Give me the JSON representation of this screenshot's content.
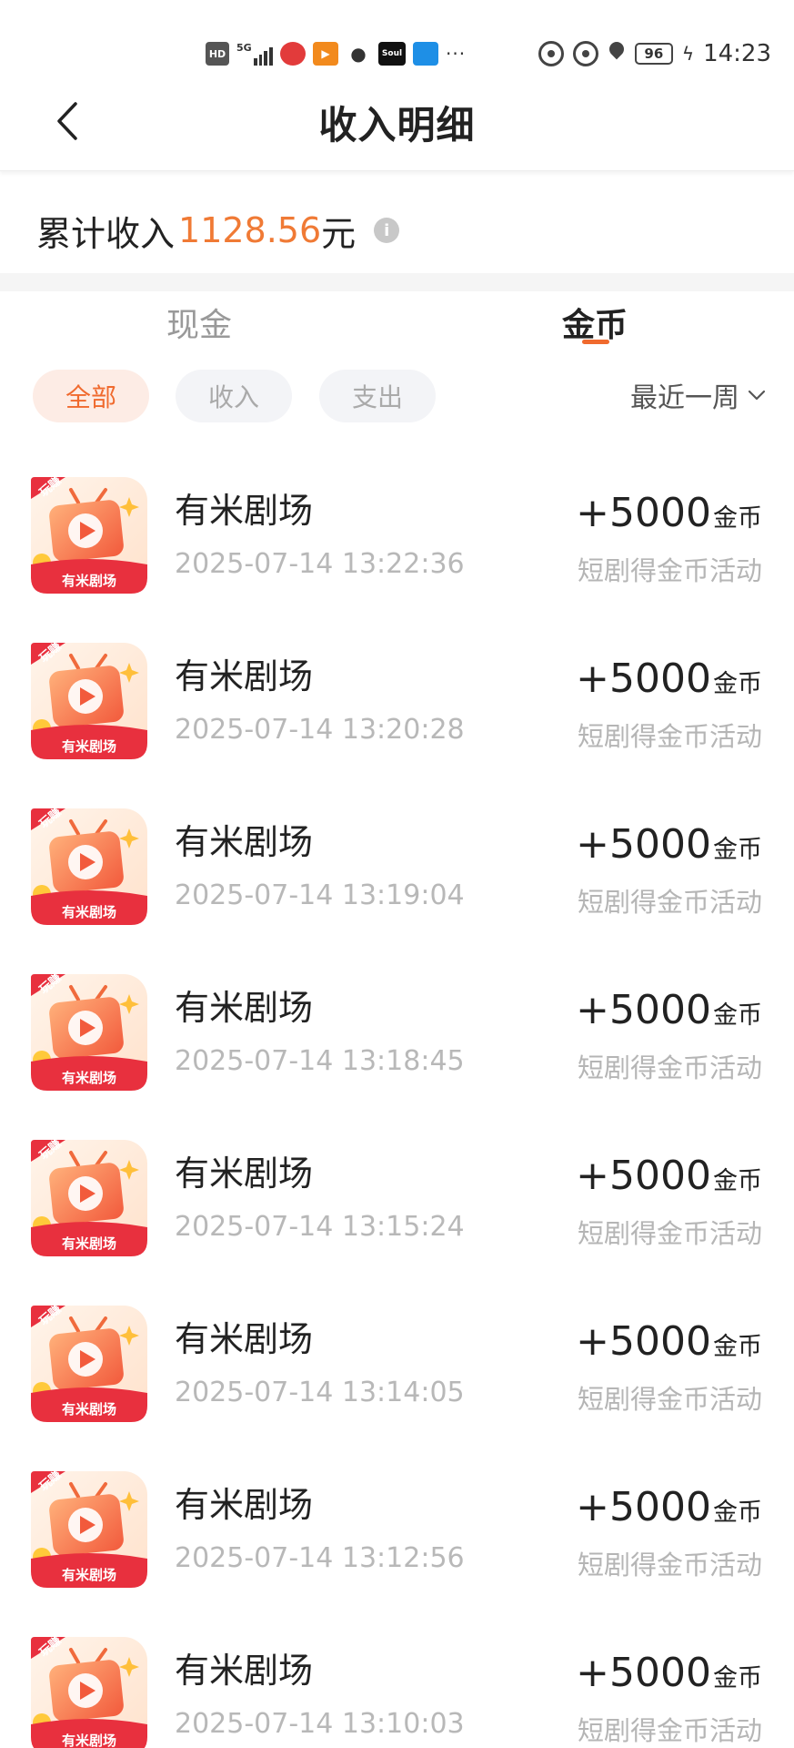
{
  "status_bar": {
    "network_hd": "HD",
    "network_5g": "5G",
    "app_soul": "Soul",
    "more": "···",
    "battery": "96",
    "time": "14:23"
  },
  "header": {
    "title": "收入明细"
  },
  "summary": {
    "label": "累计收入",
    "value": "1128.56",
    "unit": "元",
    "info_icon": "i"
  },
  "tabs": [
    {
      "label": "现金",
      "active": false
    },
    {
      "label": "金币",
      "active": true
    }
  ],
  "filters": [
    {
      "label": "全部",
      "active": true
    },
    {
      "label": "收入",
      "active": false
    },
    {
      "label": "支出",
      "active": false
    }
  ],
  "period": {
    "label": "最近一周"
  },
  "icon": {
    "badge": "玩赚",
    "label": "有米剧场"
  },
  "records": [
    {
      "name": "有米剧场",
      "time": "2025-07-14 13:22:36",
      "amount": "+5000",
      "unit": "金币",
      "desc": "短剧得金币活动"
    },
    {
      "name": "有米剧场",
      "time": "2025-07-14 13:20:28",
      "amount": "+5000",
      "unit": "金币",
      "desc": "短剧得金币活动"
    },
    {
      "name": "有米剧场",
      "time": "2025-07-14 13:19:04",
      "amount": "+5000",
      "unit": "金币",
      "desc": "短剧得金币活动"
    },
    {
      "name": "有米剧场",
      "time": "2025-07-14 13:18:45",
      "amount": "+5000",
      "unit": "金币",
      "desc": "短剧得金币活动"
    },
    {
      "name": "有米剧场",
      "time": "2025-07-14 13:15:24",
      "amount": "+5000",
      "unit": "金币",
      "desc": "短剧得金币活动"
    },
    {
      "name": "有米剧场",
      "time": "2025-07-14 13:14:05",
      "amount": "+5000",
      "unit": "金币",
      "desc": "短剧得金币活动"
    },
    {
      "name": "有米剧场",
      "time": "2025-07-14 13:12:56",
      "amount": "+5000",
      "unit": "金币",
      "desc": "短剧得金币活动"
    },
    {
      "name": "有米剧场",
      "time": "2025-07-14 13:10:03",
      "amount": "+5000",
      "unit": "金币",
      "desc": "短剧得金币活动"
    }
  ],
  "colors": {
    "accent": "#f06a2e",
    "amount_highlight": "#f07a35",
    "icon_red": "#e8303e"
  }
}
